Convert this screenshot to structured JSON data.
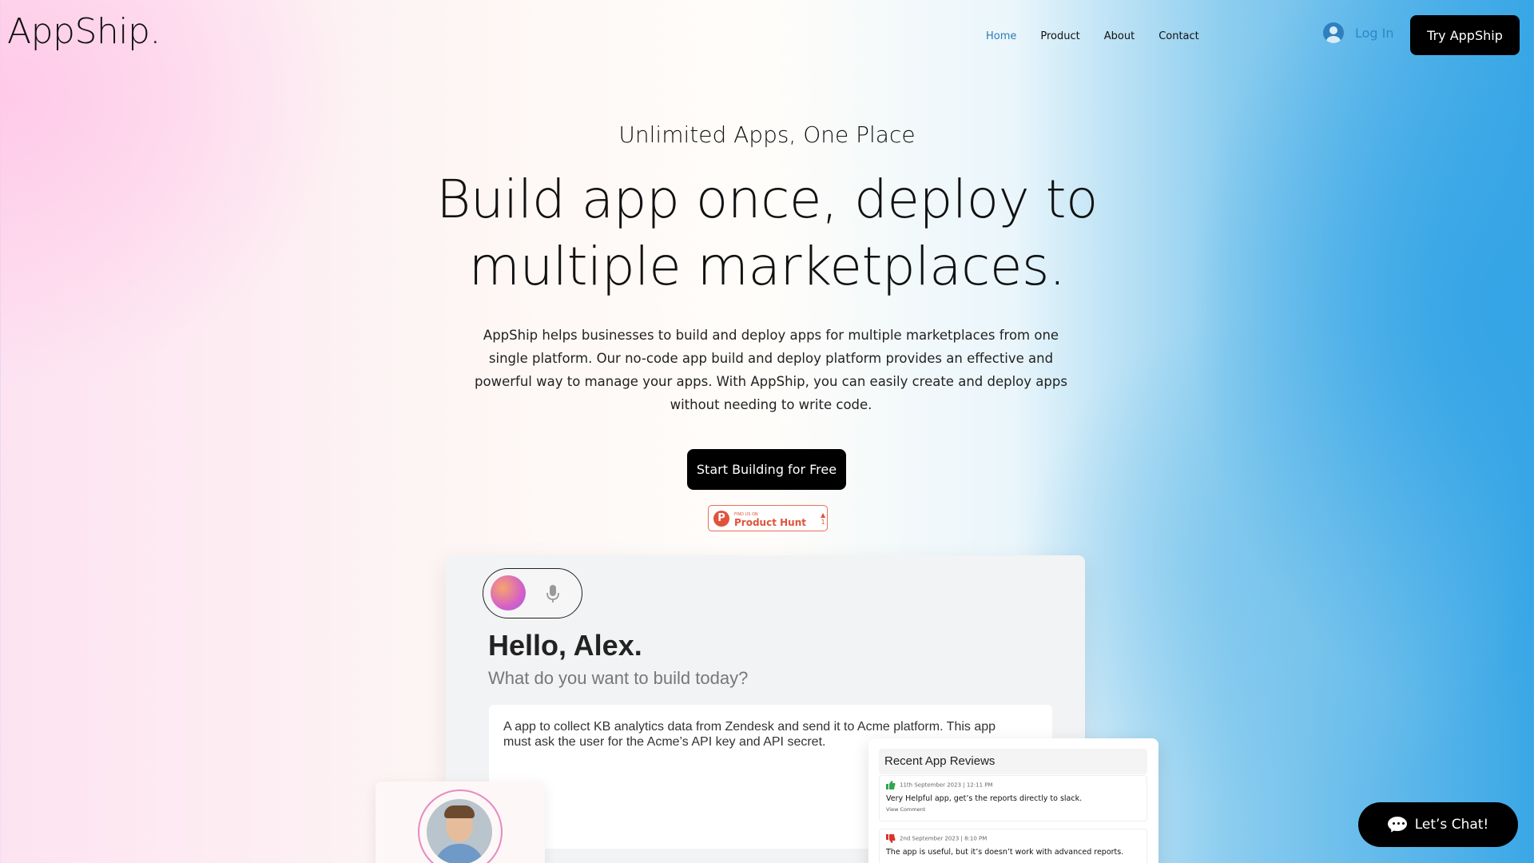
{
  "header": {
    "logo": "AppShip.",
    "nav": [
      "Home",
      "Product",
      "About",
      "Contact"
    ],
    "active_nav": "Home",
    "login_label": "Log In",
    "try_label": "Try AppShip"
  },
  "hero": {
    "eyebrow": "Unlimited Apps, One Place",
    "headline": "Build app once, deploy to multiple marketplaces.",
    "description": "AppShip helps businesses to build and deploy apps for multiple marketplaces from one single platform. Our no-code app build and deploy platform provides an effective and powerful way to manage your apps. With AppShip, you can easily create and deploy apps without needing to write code.",
    "cta_label": "Start Building for Free",
    "product_hunt": {
      "small": "FIND US ON",
      "name": "Product Hunt",
      "votes": "1"
    }
  },
  "dashboard": {
    "greeting": "Hello, Alex.",
    "subtitle": "What do you want to build today?",
    "prompt": "A app to collect KB analytics data from Zendesk and send it to Acme platform. This app must ask the user for the Acme’s API key and API secret."
  },
  "reviews": {
    "title": "Recent App Reviews",
    "items": [
      {
        "date": "11th September 2023 | 12:11 PM",
        "text": "Very Helpful app, get’s the reports directly to slack.",
        "link": "View Comment",
        "sentiment": "positive"
      },
      {
        "date": "2nd September 2023 | 8:10 PM",
        "text": "The app is useful, but it’s doesn’t work with advanced reports.",
        "sentiment": "negative"
      }
    ]
  },
  "chat": {
    "label": "Let’s Chat!"
  },
  "colors": {
    "accent": "#2c7bb6",
    "button_bg": "#000000",
    "product_hunt": "#e0533a",
    "thumb_up": "#2fa84f",
    "thumb_down": "#d9342b"
  }
}
